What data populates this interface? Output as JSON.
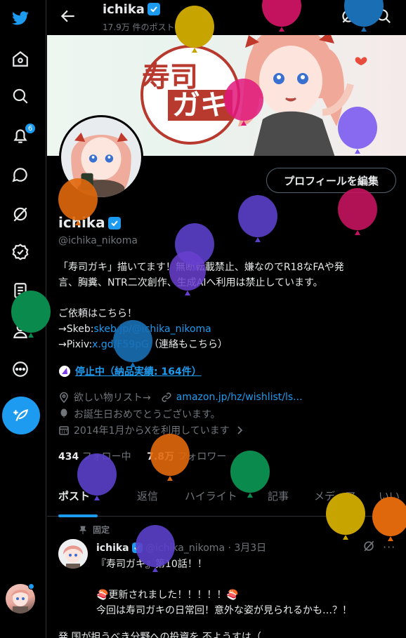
{
  "nav": {
    "notification_count": "6",
    "items": [
      "x-logo-icon",
      "home-icon",
      "explore-icon",
      "notifications-icon",
      "messages-icon",
      "grok-icon",
      "verified-orgs-icon",
      "lists-icon",
      "profile-icon",
      "more-icon"
    ]
  },
  "header": {
    "name": "ichika",
    "post_count": "17.9万 件のポスト"
  },
  "banner": {
    "logo_line1": "寿司",
    "logo_line2": "ガキ"
  },
  "profile": {
    "edit_button": "プロフィールを編集",
    "display_name": "ichika",
    "handle": "@ichika_nikoma",
    "bio_lines": [
      "「寿司ガキ」描いてます！無断転載禁止、嫌なのでR18なFAや発",
      "言、胸糞、NTR二次創作、生成AIへ利用は禁止しています。",
      "",
      "ご依頼はこちら！"
    ],
    "skeb_prefix": "→Skeb:",
    "skeb_link": "skeb.jp/@ichika_nikoma",
    "pixiv_prefix": "→Pixiv:",
    "pixiv_link": "x.gd/F59pG",
    "pixiv_suffix": "（連絡もこちら）",
    "subscription": "停止中（納品実績: 164件）",
    "wishlist_label": "欲しい物リスト→",
    "wishlist_link": "amazon.jp/hz/wishlist/ls...",
    "birthday": "お誕生日おめでとうございます。",
    "joined": "2014年1月からXを利用しています",
    "following_count": "434",
    "following_label": "フォロー中",
    "followers_count": "7.8万",
    "followers_label": "フォロワー"
  },
  "tabs": [
    "ポスト",
    "返信",
    "ハイライト",
    "記事",
    "メディア",
    "いい"
  ],
  "pinned_post": {
    "pinned_label": "固定",
    "author": "ichika",
    "handle_date": "@ichika_nikoma · 3月3日",
    "lines": [
      "『寿司ガキ』第10話！！",
      "",
      "🍣更新されました！！！！！🍣",
      "今回は寿司ガキの日常回！意外な姿が見られるかも…？！"
    ],
    "cut_line": "発 国が担うべき分野への投資を 丕ようすは（"
  },
  "colors": {
    "accent": "#1d9bf0",
    "background": "#000000",
    "text": "#e7e9ea",
    "muted": "#71767b"
  }
}
